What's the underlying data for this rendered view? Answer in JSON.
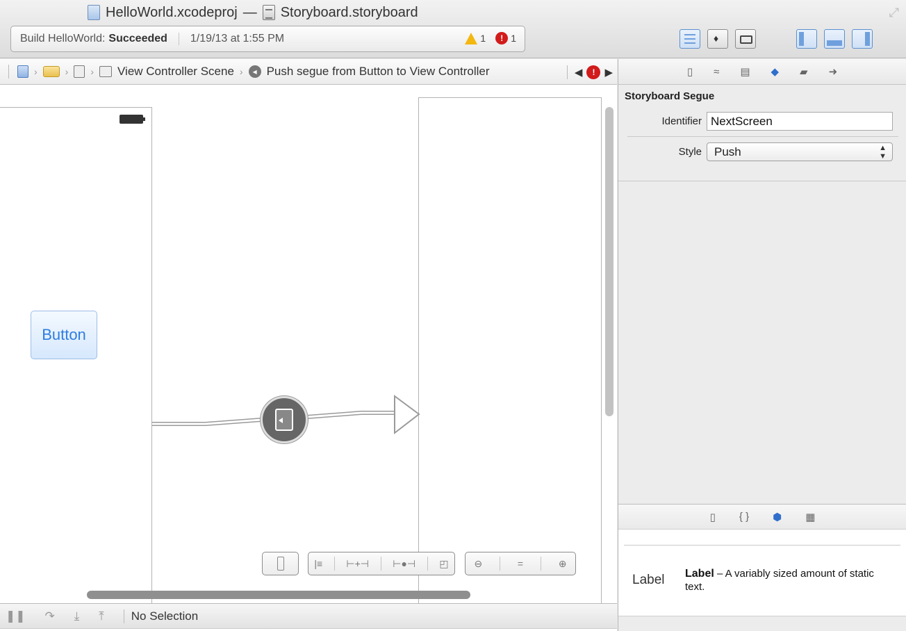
{
  "window": {
    "project_name": "HelloWorld.xcodeproj",
    "title_separator": "—",
    "file_name": "Storyboard.storyboard"
  },
  "activity": {
    "prefix": "Build HelloWorld:",
    "status": "Succeeded",
    "timestamp": "1/19/13 at 1:55 PM",
    "warning_count": "1",
    "error_count": "1"
  },
  "jumpbar": {
    "scene": "View Controller Scene",
    "segue": "Push segue from Button to View Controller",
    "chevron": "›"
  },
  "inspector": {
    "section_title": "Storyboard Segue",
    "identifier_label": "Identifier",
    "identifier_value": "NextScreen",
    "style_label": "Style",
    "style_value": "Push"
  },
  "library": {
    "item_glyph": "Label",
    "item_name": "Label",
    "item_desc": " – A variably sized amount of static text."
  },
  "canvas": {
    "button_label": "Button"
  },
  "debug": {
    "selection": "No Selection"
  },
  "colors": {
    "accent": "#2f6fcb",
    "warning": "#f3b70f",
    "error": "#d21b1b"
  }
}
